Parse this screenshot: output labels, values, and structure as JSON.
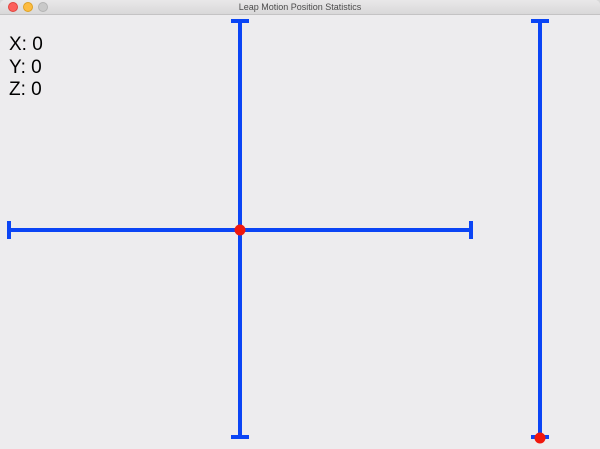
{
  "window": {
    "title": "Leap Motion Position Statistics"
  },
  "readout": {
    "x_text": "X: 0",
    "y_text": "Y: 0",
    "z_text": "Z: 0"
  },
  "position": {
    "x": 0,
    "y": 0,
    "z": 0
  },
  "colors": {
    "axis": "#0b45f5",
    "marker": "#f0170d",
    "background": "#edecee"
  }
}
